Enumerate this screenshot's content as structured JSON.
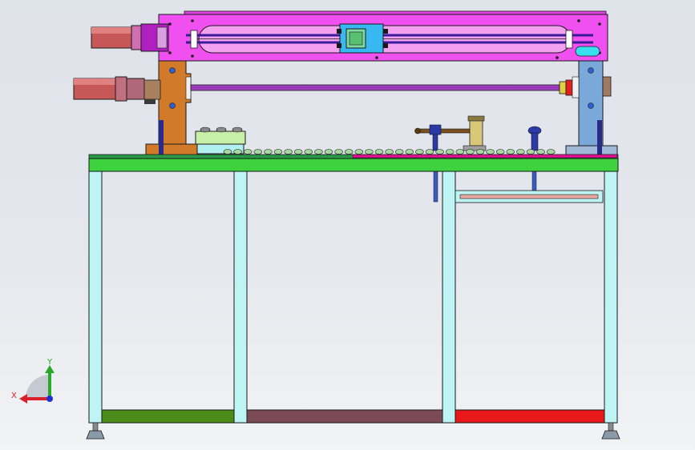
{
  "viewport": {
    "background_top": "#dfe3ea",
    "background_bottom": "#f2f3f5"
  },
  "triad": {
    "x_label": "X",
    "y_label": "Y",
    "x_color": "#d8202a",
    "y_color": "#2aa82a",
    "z_color": "#2030d0"
  },
  "colors": {
    "frame_leg": "#bff4f4",
    "tabletop": "#3fd23f",
    "beam_upper": "#f050f0",
    "slider": "#38b8f0",
    "slider_core": "#7fd8a0",
    "motor_gray": "#9a9a9a",
    "motor_purple": "#b83ac8",
    "bracket_left": "#d07a2a",
    "bracket_right": "#7aa8d8",
    "rod": "#a040c0",
    "foot_green": "#4c8a1a",
    "foot_brown": "#7a4a55",
    "foot_red": "#e81818",
    "rail_pink": "#e01090",
    "outline": "#1a1a1a"
  },
  "components": [
    "upper-linear-module",
    "lower-linear-module",
    "left-bracket",
    "right-bracket",
    "servo-motor-upper",
    "servo-motor-lower",
    "slider-carriage",
    "workbench-frame",
    "tabletop",
    "conveyor-rollers",
    "feeder-block",
    "clamp-handle",
    "cylinder-post",
    "lower-shelf",
    "leveling-feet"
  ]
}
